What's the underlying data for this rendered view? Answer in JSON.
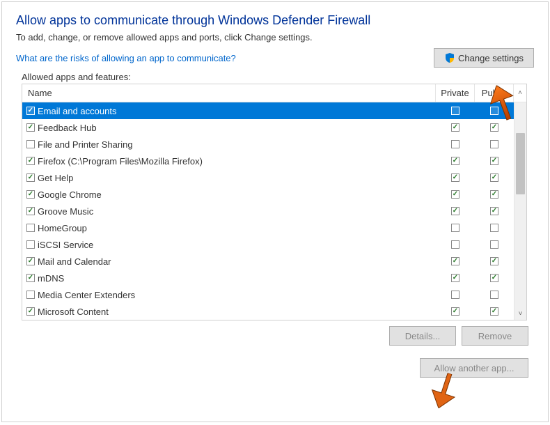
{
  "header": {
    "title": "Allow apps to communicate through Windows Defender Firewall",
    "subtitle": "To add, change, or remove allowed apps and ports, click Change settings.",
    "risk_link": "What are the risks of allowing an app to communicate?",
    "change_settings_label": "Change settings"
  },
  "list": {
    "section_label": "Allowed apps and features:",
    "columns": {
      "name": "Name",
      "private": "Private",
      "public": "Public"
    },
    "rows": [
      {
        "name": "Email and accounts",
        "enabled": true,
        "private": false,
        "public": false,
        "selected": true
      },
      {
        "name": "Feedback Hub",
        "enabled": true,
        "private": true,
        "public": true
      },
      {
        "name": "File and Printer Sharing",
        "enabled": false,
        "private": false,
        "public": false
      },
      {
        "name": "Firefox (C:\\Program Files\\Mozilla Firefox)",
        "enabled": true,
        "private": true,
        "public": true
      },
      {
        "name": "Get Help",
        "enabled": true,
        "private": true,
        "public": true
      },
      {
        "name": "Google Chrome",
        "enabled": true,
        "private": true,
        "public": true
      },
      {
        "name": "Groove Music",
        "enabled": true,
        "private": true,
        "public": true
      },
      {
        "name": "HomeGroup",
        "enabled": false,
        "private": false,
        "public": false
      },
      {
        "name": "iSCSI Service",
        "enabled": false,
        "private": false,
        "public": false
      },
      {
        "name": "Mail and Calendar",
        "enabled": true,
        "private": true,
        "public": true
      },
      {
        "name": "mDNS",
        "enabled": true,
        "private": true,
        "public": true
      },
      {
        "name": "Media Center Extenders",
        "enabled": false,
        "private": false,
        "public": false
      },
      {
        "name": "Microsoft Content",
        "enabled": true,
        "private": true,
        "public": true
      }
    ]
  },
  "buttons": {
    "details": "Details...",
    "remove": "Remove",
    "allow_another": "Allow another app..."
  }
}
